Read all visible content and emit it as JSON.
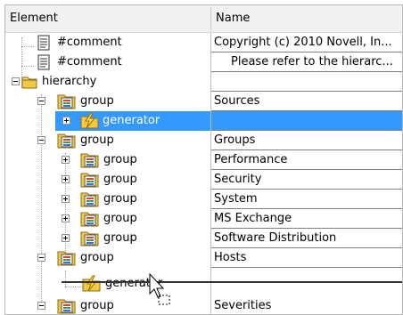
{
  "columns": {
    "element": "Element",
    "name": "Name"
  },
  "rows": [
    {
      "label": "#comment",
      "name": "Copyright (c) 2010 Novell, In...",
      "icon": "document-icon"
    },
    {
      "label": "#comment",
      "name": "Please refer to the hierarc...",
      "icon": "document-icon"
    },
    {
      "label": "hierarchy",
      "name": "",
      "icon": "folder-icon",
      "expanded": true
    },
    {
      "label": "group",
      "name": "Sources",
      "icon": "group-folder-icon",
      "expanded": true
    },
    {
      "label": "generator",
      "name": "",
      "icon": "generator-icon",
      "expanded": false,
      "selected": true
    },
    {
      "label": "group",
      "name": "Groups",
      "icon": "group-folder-icon",
      "expanded": true
    },
    {
      "label": "group",
      "name": "Performance",
      "icon": "group-folder-icon",
      "expanded": false
    },
    {
      "label": "group",
      "name": "Security",
      "icon": "group-folder-icon",
      "expanded": false
    },
    {
      "label": "group",
      "name": "System",
      "icon": "group-folder-icon",
      "expanded": false
    },
    {
      "label": "group",
      "name": "MS Exchange",
      "icon": "group-folder-icon",
      "expanded": false
    },
    {
      "label": "group",
      "name": "Software Distribution",
      "icon": "group-folder-icon",
      "expanded": false
    },
    {
      "label": "group",
      "name": "Hosts",
      "icon": "group-folder-icon",
      "expanded": true
    },
    {
      "label": "generator",
      "name": "",
      "icon": "generator-icon"
    },
    {
      "label": "group",
      "name": "Severities",
      "icon": "group-folder-icon",
      "expanded": true
    }
  ],
  "drag": {
    "cursor": "drag-copy-cursor",
    "indicator": "drop-position-line"
  },
  "colors": {
    "selection": "#3399ff",
    "header": "#f1f1f1"
  }
}
